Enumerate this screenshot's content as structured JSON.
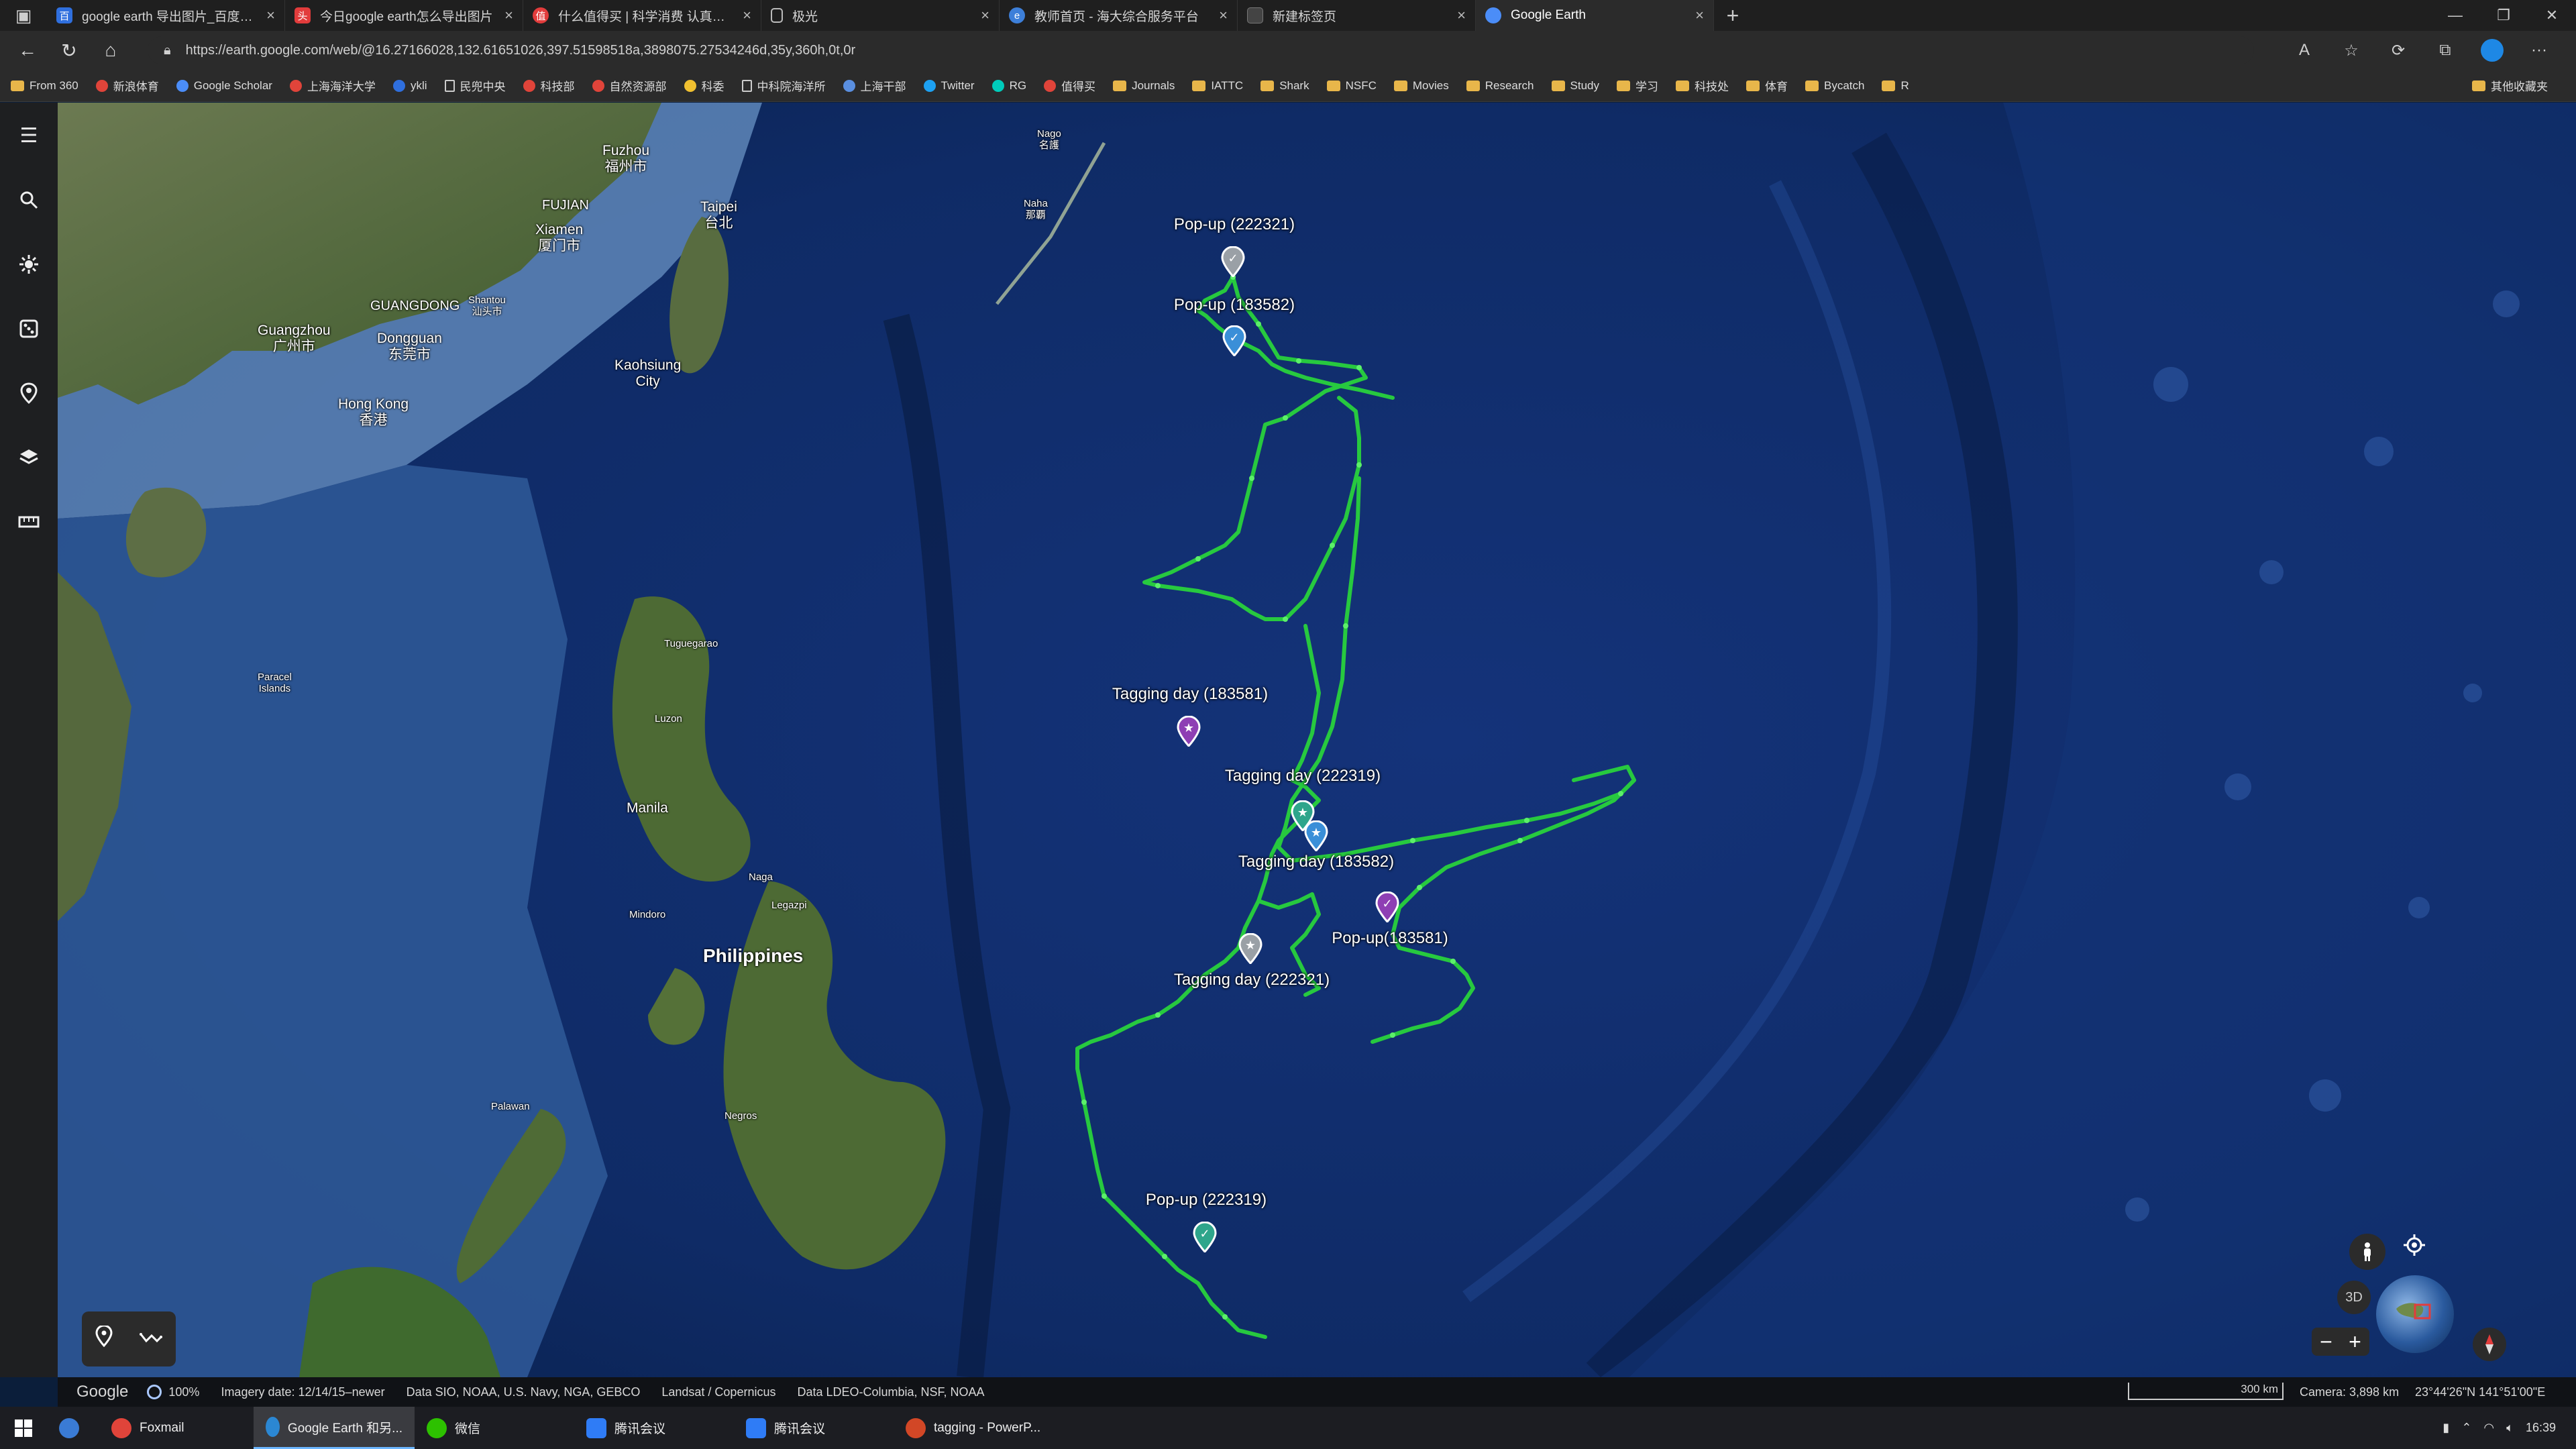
{
  "browser": {
    "tabs": [
      {
        "title": "google earth 导出图片_百度搜索",
        "icon": "baidu-icon",
        "color": "#2f6fde"
      },
      {
        "title": "今日google earth怎么导出图片",
        "icon": "toutiao-icon",
        "color": "#e23c3c"
      },
      {
        "title": "什么值得买 | 科学消费 认真生活",
        "icon": "smzdm-icon",
        "color": "#e23c3c"
      },
      {
        "title": "极光",
        "icon": "page-icon",
        "color": "#777777"
      },
      {
        "title": "教师首页 - 海大综合服务平台",
        "icon": "edge-icon",
        "color": "#3d7fd9"
      },
      {
        "title": "新建标签页",
        "icon": "newtab-icon",
        "color": "#444444"
      },
      {
        "title": "Google Earth",
        "icon": "google-earth-icon",
        "color": "#4b8df8",
        "active": true
      }
    ],
    "url": "https://earth.google.com/web/@16.27166028,132.61651026,397.51598518a,3898075.27534246d,35y,360h,0t,0r",
    "bookmarks": [
      {
        "label": "From 360",
        "type": "folder"
      },
      {
        "label": "新浪体育",
        "type": "site",
        "color": "#e0443a"
      },
      {
        "label": "Google Scholar",
        "type": "site",
        "color": "#4b8df8"
      },
      {
        "label": "上海海洋大学",
        "type": "site",
        "color": "#e0443a"
      },
      {
        "label": "ykli",
        "type": "site",
        "color": "#2f6fde"
      },
      {
        "label": "民兜中央",
        "type": "page"
      },
      {
        "label": "科技部",
        "type": "site",
        "color": "#e0443a"
      },
      {
        "label": "自然资源部",
        "type": "site",
        "color": "#e0443a"
      },
      {
        "label": "科委",
        "type": "site",
        "color": "#f0c030"
      },
      {
        "label": "中科院海洋所",
        "type": "page"
      },
      {
        "label": "上海干部",
        "type": "site",
        "color": "#5a8fe0"
      },
      {
        "label": "Twitter",
        "type": "site",
        "color": "#1da1f2"
      },
      {
        "label": "RG",
        "type": "site",
        "color": "#00ccbb"
      },
      {
        "label": "值得买",
        "type": "site",
        "color": "#e0443a"
      },
      {
        "label": "Journals",
        "type": "folder"
      },
      {
        "label": "IATTC",
        "type": "folder"
      },
      {
        "label": "Shark",
        "type": "folder"
      },
      {
        "label": "NSFC",
        "type": "folder"
      },
      {
        "label": "Movies",
        "type": "folder"
      },
      {
        "label": "Research",
        "type": "folder"
      },
      {
        "label": "Study",
        "type": "folder"
      },
      {
        "label": "学习",
        "type": "folder"
      },
      {
        "label": "科技处",
        "type": "folder"
      },
      {
        "label": "体育",
        "type": "folder"
      },
      {
        "label": "Bycatch",
        "type": "folder"
      },
      {
        "label": "R",
        "type": "folder"
      }
    ],
    "bookmarks_other": "其他收藏夹"
  },
  "map": {
    "place_labels": {
      "fuzhou": "Fuzhou\n福州市",
      "fujian": "FUJIAN",
      "xiamen": "Xiamen\n厦门市",
      "taipei": "Taipei\n台北",
      "guangzhou": "Guangzhou\n广州市",
      "guangdong": "GUANGDONG",
      "shantou": "Shantou\n汕头市",
      "dongguan": "Dongguan\n东莞市",
      "hongkong": "Hong Kong\n香港",
      "kaohsiung": "Kaohsiung\nCity",
      "nago": "Nago\n名護",
      "naha": "Naha\n那覇",
      "paracel": "Paracel\nIslands",
      "tuguegarao": "Tuguegarao",
      "luzon": "Luzon",
      "manila": "Manila",
      "mindoro": "Mindoro",
      "naga": "Naga",
      "legazpi": "Legazpi",
      "philippines": "Philippines",
      "palawan": "Palawan",
      "negros": "Negros"
    },
    "placemarks": [
      {
        "id": "popup-222321",
        "label": "Pop-up (222321)",
        "color": "#9aa0a6",
        "symbol": "✓"
      },
      {
        "id": "popup-183582",
        "label": "Pop-up (183582)",
        "color": "#3a8fd8",
        "symbol": "✓"
      },
      {
        "id": "tagging-183581",
        "label": "Tagging day (183581)",
        "color": "#8e3fb4",
        "symbol": "★"
      },
      {
        "id": "tagging-222319",
        "label": "Tagging day (222319)",
        "color": "#2ea58b",
        "symbol": "★"
      },
      {
        "id": "tagging-183582",
        "label": "Tagging day (183582)",
        "color": "#3a8fd8",
        "symbol": "★"
      },
      {
        "id": "popup-183581",
        "label": "Pop-up(183581)",
        "color": "#8e3fb4",
        "symbol": "✓"
      },
      {
        "id": "tagging-222321",
        "label": "Tagging day (222321)",
        "color": "#9aa0a6",
        "symbol": "★"
      },
      {
        "id": "popup-222319",
        "label": "Pop-up (222319)",
        "color": "#2ea58b",
        "symbol": "✓"
      }
    ],
    "track_color": "#27c93f"
  },
  "rail": {
    "items": [
      "menu-icon",
      "search-icon",
      "voyager-icon",
      "feeling-lucky-icon",
      "projects-icon",
      "map-style-icon",
      "measure-icon"
    ]
  },
  "controls": {
    "mode_3d": "3D",
    "zoom_in": "+",
    "zoom_out": "−"
  },
  "status": {
    "google": "Google",
    "loading": "100%",
    "imagery_date": "Imagery date: 12/14/15–newer",
    "credits_1": "Data SIO, NOAA, U.S. Navy, NGA, GEBCO",
    "credits_2": "Landsat / Copernicus",
    "credits_3": "Data LDEO-Columbia, NSF, NOAA",
    "scale": "300 km",
    "camera": "Camera: 3,898 km",
    "coords": "23°44'26\"N 141°51'00\"E"
  },
  "taskbar": {
    "items": [
      {
        "label": "Foxmail",
        "color": "#e0443a"
      },
      {
        "label": "Google Earth 和另...",
        "color": "#4b8df8",
        "active": true
      },
      {
        "label": "微信",
        "color": "#2dc100"
      },
      {
        "label": "腾讯会议",
        "color": "#2f7cf6"
      },
      {
        "label": "腾讯会议",
        "color": "#2f7cf6"
      },
      {
        "label": "tagging - PowerP...",
        "color": "#d24726"
      }
    ],
    "time": "16:39"
  }
}
